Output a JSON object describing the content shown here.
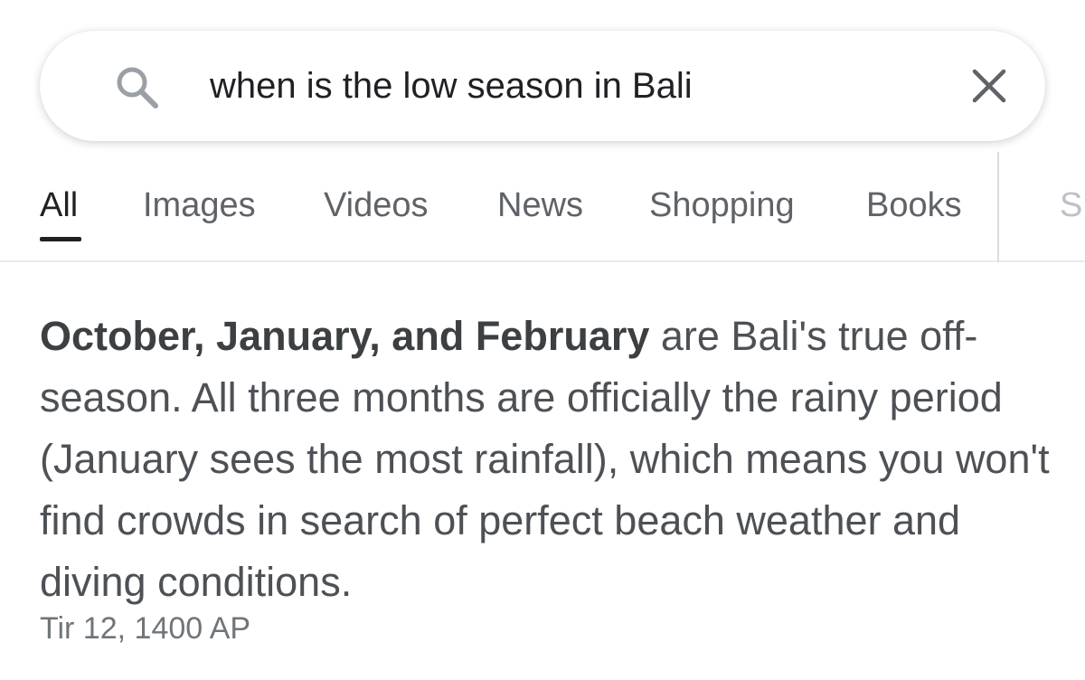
{
  "search": {
    "query": "when is the low season in Bali"
  },
  "tabs": [
    {
      "label": "All",
      "active": true
    },
    {
      "label": "Images",
      "active": false
    },
    {
      "label": "Videos",
      "active": false
    },
    {
      "label": "News",
      "active": false
    },
    {
      "label": "Shopping",
      "active": false
    },
    {
      "label": "Books",
      "active": false
    }
  ],
  "tab_cut_label": "S",
  "answer": {
    "highlight": "October, January, and February",
    "text": " are Bali's true off-season. All three months are officially the rainy period (January sees the most rainfall), which means you won't find crowds in search of perfect beach weather and diving conditions.",
    "date": "Tir 12, 1400 AP"
  },
  "icons": {
    "search": "search-icon",
    "close": "close-icon"
  }
}
